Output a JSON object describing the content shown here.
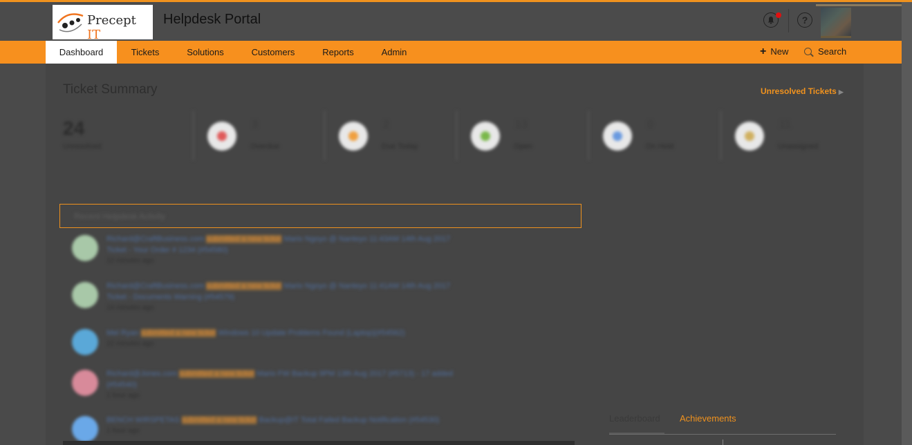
{
  "header": {
    "brand_name": "Precept",
    "brand_suffix": "IT",
    "portal_title": "Helpdesk Portal",
    "help_glyph": "?",
    "icons": [
      "bell-icon",
      "help-icon",
      "avatar"
    ]
  },
  "nav": {
    "items": [
      {
        "label": "Dashboard",
        "active": true
      },
      {
        "label": "Tickets",
        "active": false
      },
      {
        "label": "Solutions",
        "active": false
      },
      {
        "label": "Customers",
        "active": false
      },
      {
        "label": "Reports",
        "active": false
      },
      {
        "label": "Admin",
        "active": false
      }
    ],
    "new_label": "New",
    "search_label": "Search"
  },
  "summary": {
    "title": "Ticket Summary",
    "unresolved_link": "Unresolved Tickets",
    "big_stat": {
      "value": "24",
      "label": "Unresolved"
    },
    "stats": [
      {
        "value": "3",
        "label": "Overdue",
        "color": "#e05a5a"
      },
      {
        "value": "2",
        "label": "Due Today",
        "color": "#f0a040"
      },
      {
        "value": "13",
        "label": "Open",
        "color": "#7ab84a"
      },
      {
        "value": "0",
        "label": "On Hold",
        "color": "#6a9ae0"
      },
      {
        "value": "11",
        "label": "Unassigned",
        "color": "#d0b060"
      }
    ]
  },
  "activity": {
    "title": "Recent Helpdesk Activity",
    "items": [
      {
        "user": "Richard@CraftBusiness.com",
        "action": "submitted a new ticket",
        "detail": "Mario Ngoyo @ Nanteyo 11:43AM 14th Aug 2017",
        "detail2": "Ticket - Your Order # 1234 (#54580)",
        "time": "12 minutes ago",
        "avatar_color": "#a8c8a8"
      },
      {
        "user": "Richard@CraftBusiness.com",
        "action": "submitted a new ticket",
        "detail": "Mario Ngoyo @ Nanteyo 11:41AM 14th Aug 2017",
        "detail2": "Ticket - Documents Warning (#54579)",
        "time": "14 minutes ago",
        "avatar_color": "#a8c8a8"
      },
      {
        "user": "Mel Ryan",
        "action": "submitted a new ticket",
        "detail": "Windows 10 Update Problems Found (Laptop)(#54562)",
        "detail2": "",
        "time": "22 minutes ago",
        "avatar_color": "#5aa8d8"
      },
      {
        "user": "Richard@Jones.com",
        "action": "submitted a new ticket",
        "detail": "Mario FW Backup 9PM 13th Aug 2017 (#5713) - 17 added",
        "detail2": "(#54540)",
        "time": "1 hour ago",
        "avatar_color": "#d88a9a"
      },
      {
        "user": "BENCH WIRSPETAS",
        "action": "submitted a new ticket",
        "detail": "Backup@IT Total Failed Backup Notification (#54530)",
        "detail2": "",
        "time": "1 hour ago",
        "avatar_color": "#6aa8e8"
      }
    ]
  },
  "leaderboard": {
    "tabs": [
      {
        "label": "Leaderboard",
        "active": false
      },
      {
        "label": "Achievements",
        "active": true
      }
    ]
  },
  "colors": {
    "accent": "#f7901e",
    "header_bg": "#4b4b4b",
    "overlay_bg": "#454545",
    "notification_dot": "#e01010"
  }
}
